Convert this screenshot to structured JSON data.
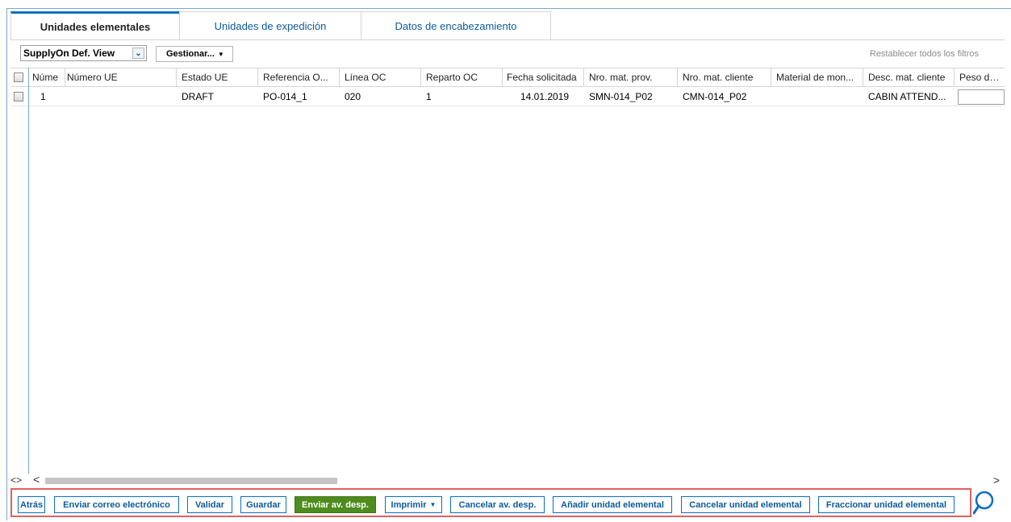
{
  "tabs": [
    {
      "label": "Unidades elementales",
      "active": true
    },
    {
      "label": "Unidades de expedición",
      "active": false
    },
    {
      "label": "Datos de encabezamiento",
      "active": false
    }
  ],
  "toolbar": {
    "view_select": "SupplyOn Def. View",
    "manage_label": "Gestionar...",
    "reset_filters": "Restablecer todos los filtros"
  },
  "grid": {
    "columns": [
      "Núme",
      "Número UE",
      "Estado UE",
      "Referencia O...",
      "Línea OC",
      "Reparto OC",
      "Fecha solicitada",
      "Nro. mat. prov.",
      "Nro. mat. cliente",
      "Material de mon...",
      "Desc. mat. cliente",
      "Peso de U"
    ],
    "rows": [
      [
        "1",
        "",
        "DRAFT",
        "PO-014_1",
        "020",
        "1",
        "14.01.2019",
        "SMN-014_P02",
        "CMN-014_P02",
        "",
        "CABIN ATTEND...",
        ""
      ]
    ]
  },
  "scroll": {
    "lr": "<>",
    "left": "<",
    "right": ">"
  },
  "actions": {
    "back": "Atrás",
    "email": "Enviar correo electrónico",
    "validate": "Validar",
    "save": "Guardar",
    "send": "Enviar av. desp.",
    "print": "Imprimir",
    "cancel_dn": "Cancelar av. desp.",
    "add_unit": "Añadir unidad elemental",
    "cancel_unit": "Cancelar unidad elemental",
    "split_unit": "Fraccionar unidad elemental"
  },
  "icons": {
    "search": "search-icon",
    "dropdown": "chevron-down-icon"
  },
  "colors": {
    "accent": "#0b6fc2",
    "primary_button": "#4e8c1e",
    "highlight_border": "#e06060"
  }
}
